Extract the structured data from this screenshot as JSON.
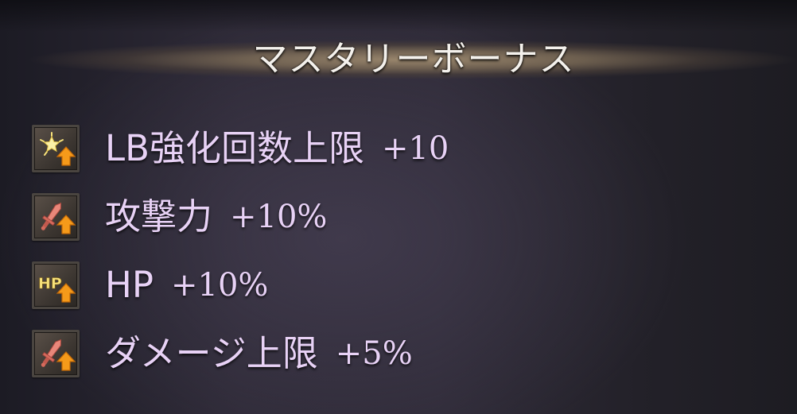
{
  "panel": {
    "title": "マスタリーボーナス"
  },
  "bonuses": [
    {
      "icon": "limit-break-star-icon",
      "label": "LB強化回数上限",
      "value": "+10"
    },
    {
      "icon": "sword-attack-up-icon",
      "label": "攻撃力",
      "value": "+10%"
    },
    {
      "icon": "hp-up-icon",
      "label": "HP",
      "value": "+10%"
    },
    {
      "icon": "sword-damage-cap-up-icon",
      "label": "ダメージ上限",
      "value": "+5%"
    }
  ],
  "colors": {
    "label_text": "#e8d2f6",
    "title_text": "#f4f1ec",
    "header_band": "#a08c70",
    "up_arrow": "#f59a1a"
  }
}
